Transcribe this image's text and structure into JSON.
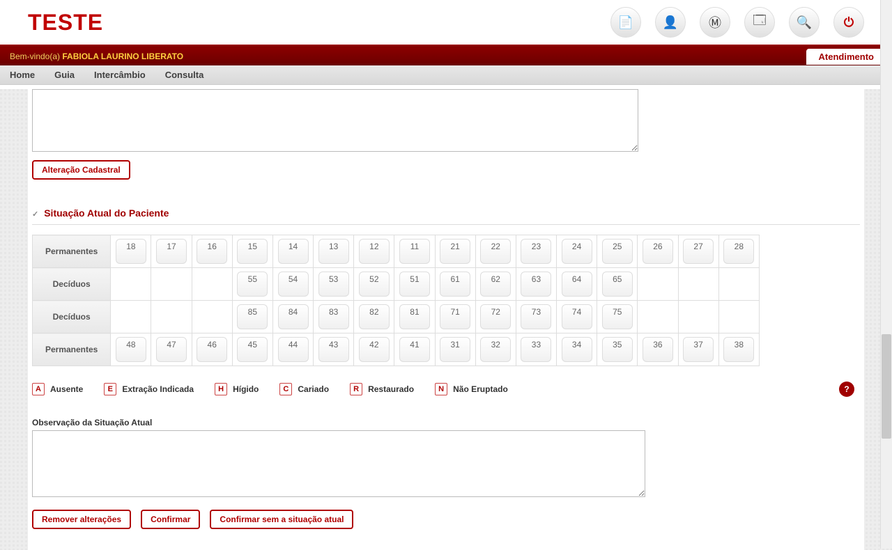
{
  "header": {
    "logo": "TESTE"
  },
  "welcome": {
    "prefix": "Bem-vindo(a) ",
    "user": "FABIOLA LAURINO LIBERATO",
    "tab": "Atendimento"
  },
  "menu": [
    "Home",
    "Guia",
    "Intercâmbio",
    "Consulta"
  ],
  "buttons": {
    "alteracao_cadastral": "Alteração Cadastral",
    "remover_alteracoes": "Remover alterações",
    "confirmar": "Confirmar",
    "confirmar_sem_situacao": "Confirmar sem a situação atual"
  },
  "section": {
    "titulo_situacao": "Situação Atual do Paciente",
    "obs_label": "Observação da Situação Atual"
  },
  "teeth": {
    "row_labels": [
      "Permanentes",
      "Decíduos",
      "Decíduos",
      "Permanentes"
    ],
    "rows": [
      [
        "18",
        "17",
        "16",
        "15",
        "14",
        "13",
        "12",
        "11",
        "21",
        "22",
        "23",
        "24",
        "25",
        "26",
        "27",
        "28"
      ],
      [
        "",
        "",
        "",
        "55",
        "54",
        "53",
        "52",
        "51",
        "61",
        "62",
        "63",
        "64",
        "65",
        "",
        "",
        ""
      ],
      [
        "",
        "",
        "",
        "85",
        "84",
        "83",
        "82",
        "81",
        "71",
        "72",
        "73",
        "74",
        "75",
        "",
        "",
        ""
      ],
      [
        "48",
        "47",
        "46",
        "45",
        "44",
        "43",
        "42",
        "41",
        "31",
        "32",
        "33",
        "34",
        "35",
        "36",
        "37",
        "38"
      ]
    ]
  },
  "legend": [
    {
      "code": "A",
      "label": "Ausente"
    },
    {
      "code": "E",
      "label": "Extração Indicada"
    },
    {
      "code": "H",
      "label": "Hígido"
    },
    {
      "code": "C",
      "label": "Cariado"
    },
    {
      "code": "R",
      "label": "Restaurado"
    },
    {
      "code": "N",
      "label": "Não Eruptado"
    }
  ],
  "icons": {
    "doc": "📄",
    "user": "👤",
    "app": "Ⓜ",
    "windows": "🗔",
    "search": "🔍",
    "power": "⏻",
    "help": "?"
  }
}
